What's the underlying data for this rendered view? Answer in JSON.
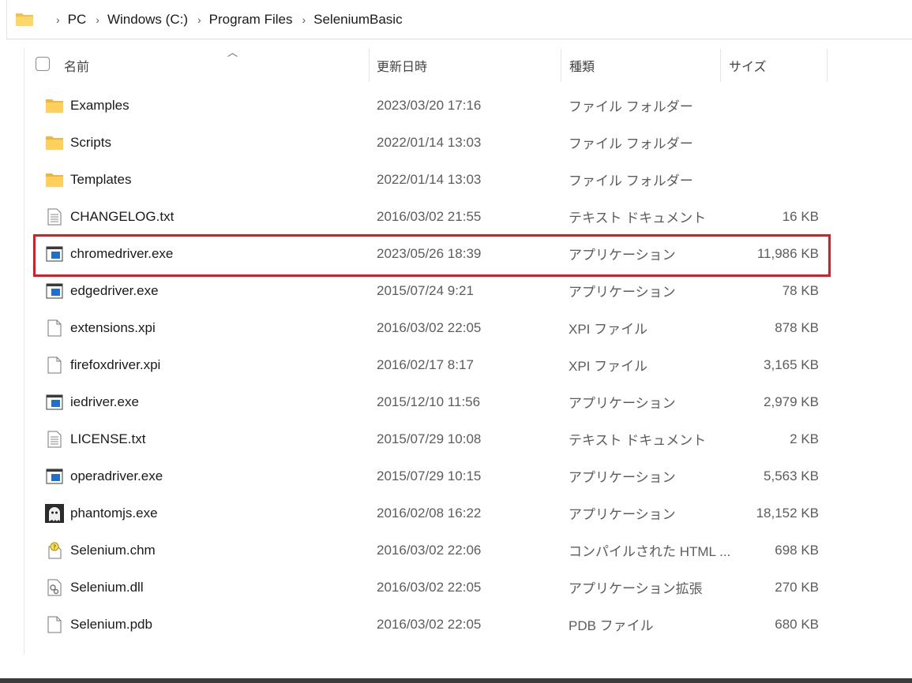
{
  "breadcrumb": [
    "PC",
    "Windows (C:)",
    "Program Files",
    "SeleniumBasic"
  ],
  "columns": {
    "name": "名前",
    "date": "更新日時",
    "type": "種類",
    "size": "サイズ"
  },
  "files": [
    {
      "name": "Examples",
      "date": "2023/03/20 17:16",
      "type": "ファイル フォルダー",
      "size": "",
      "icon": "folder-icon"
    },
    {
      "name": "Scripts",
      "date": "2022/01/14 13:03",
      "type": "ファイル フォルダー",
      "size": "",
      "icon": "folder-icon"
    },
    {
      "name": "Templates",
      "date": "2022/01/14 13:03",
      "type": "ファイル フォルダー",
      "size": "",
      "icon": "folder-icon"
    },
    {
      "name": "CHANGELOG.txt",
      "date": "2016/03/02 21:55",
      "type": "テキスト ドキュメント",
      "size": "16 KB",
      "icon": "text-file-icon"
    },
    {
      "name": "chromedriver.exe",
      "date": "2023/05/26 18:39",
      "type": "アプリケーション",
      "size": "11,986 KB",
      "icon": "app-icon"
    },
    {
      "name": "edgedriver.exe",
      "date": "2015/07/24 9:21",
      "type": "アプリケーション",
      "size": "78 KB",
      "icon": "app-icon"
    },
    {
      "name": "extensions.xpi",
      "date": "2016/03/02 22:05",
      "type": "XPI ファイル",
      "size": "878 KB",
      "icon": "blank-file-icon"
    },
    {
      "name": "firefoxdriver.xpi",
      "date": "2016/02/17 8:17",
      "type": "XPI ファイル",
      "size": "3,165 KB",
      "icon": "blank-file-icon"
    },
    {
      "name": "iedriver.exe",
      "date": "2015/12/10 11:56",
      "type": "アプリケーション",
      "size": "2,979 KB",
      "icon": "app-icon"
    },
    {
      "name": "LICENSE.txt",
      "date": "2015/07/29 10:08",
      "type": "テキスト ドキュメント",
      "size": "2 KB",
      "icon": "text-file-icon"
    },
    {
      "name": "operadriver.exe",
      "date": "2015/07/29 10:15",
      "type": "アプリケーション",
      "size": "5,563 KB",
      "icon": "app-icon"
    },
    {
      "name": "phantomjs.exe",
      "date": "2016/02/08 16:22",
      "type": "アプリケーション",
      "size": "18,152 KB",
      "icon": "ghost-icon"
    },
    {
      "name": "Selenium.chm",
      "date": "2016/03/02 22:06",
      "type": "コンパイルされた HTML ...",
      "size": "698 KB",
      "icon": "help-file-icon"
    },
    {
      "name": "Selenium.dll",
      "date": "2016/03/02 22:05",
      "type": "アプリケーション拡張",
      "size": "270 KB",
      "icon": "dll-file-icon"
    },
    {
      "name": "Selenium.pdb",
      "date": "2016/03/02 22:05",
      "type": "PDB ファイル",
      "size": "680 KB",
      "icon": "blank-file-icon"
    }
  ],
  "highlighted_row": "chromedriver.exe",
  "colors": {
    "highlight": "#e01b24",
    "folder": "#f4c04a",
    "app_blue": "#1e6fd0"
  }
}
